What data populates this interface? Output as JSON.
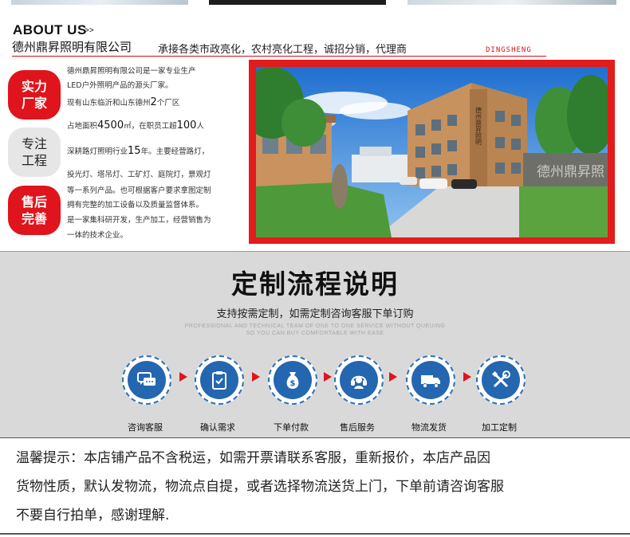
{
  "about": {
    "title": "ABOUT US",
    "arrows": ">>",
    "company_name": "德州鼎昇照明有限公司",
    "slogan": "承接各类市政亮化，农村亮化工程，诚招分销，代理商",
    "brand_en": "DINGSHENG"
  },
  "badges": [
    {
      "label": "实力厂家"
    },
    {
      "label": "专注工程"
    },
    {
      "label": "售后完善"
    }
  ],
  "intro": {
    "line1": "德州鼎昇照明有限公司是一家专业生产",
    "line2": "LED户外照明产品的源头厂家。",
    "line3a": "现有山东临沂和山东德州",
    "line3b": "2",
    "line3c": "个厂区",
    "line4a": "占地面积",
    "line4b": "4500",
    "line4c": "㎡，在职员工超",
    "line4d": "100",
    "line4e": "人",
    "line5a": "深耕路灯照明行业",
    "line5b": "15",
    "line5c": "年。主要经营路灯，",
    "line6": "投光灯、塔吊灯、工矿灯、庭院灯，景观灯",
    "line7": "等一系列产品。也可根据客户要求拿图定制",
    "line8": "拥有完整的加工设备以及质量监督体系。",
    "line9": "是一家集科研开发，生产加工，经营销售为",
    "line10": "一体的技术企业。"
  },
  "photo": {
    "building_sign": "德州鼎昇照明",
    "wall_sign": "德州鼎昇照"
  },
  "process": {
    "title": "定制流程说明",
    "subtitle": "支持按需定制，如需定制咨询客服下单订购",
    "en_line1": "PROFESSIONAL AND TECHNICAL TEAM OF ONE TO ONE SERVICE WITHOUT QUEUING",
    "en_line2": "SO YOU CAN BUY COMFORTABLE WITH EASE",
    "steps": [
      {
        "label": "咨询客服",
        "icon": "chat-icon"
      },
      {
        "label": "确认需求",
        "icon": "clipboard-icon"
      },
      {
        "label": "下单付款",
        "icon": "money-bag-icon"
      },
      {
        "label": "售后服务",
        "icon": "headset-icon"
      },
      {
        "label": "物流发货",
        "icon": "truck-icon"
      },
      {
        "label": "加工定制",
        "icon": "tools-icon"
      }
    ]
  },
  "notice": {
    "line1": "温馨提示：本店铺产品不含税运，如需开票请联系客服，重新报价，本店产品因",
    "line2": "货物性质，默认发物流，物流点自提，或者选择物流送货上门，下单前请咨询客服",
    "line3": "不要自行拍单，感谢理解."
  },
  "colors": {
    "accent_red": "#e0141c",
    "step_blue": "#2467b0",
    "process_bg": "#d9d9d9"
  }
}
